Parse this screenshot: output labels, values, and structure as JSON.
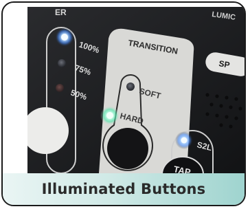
{
  "caption": "Illuminated Buttons",
  "panel": {
    "level_labels": [
      "100%",
      "75%",
      "50%"
    ],
    "transition_title": "TRANSITION",
    "soft_label": "SOFT",
    "hard_label": "HARD",
    "s2l_label": "S2L",
    "tap_label": "TAP",
    "partial_top_label": "ER",
    "partial_right_label": "LUMIC",
    "partial_sp_label": "SP"
  },
  "colors": {
    "led_blue": "#7fb8ff",
    "led_green": "#9fffd0",
    "panel_dark": "#1a1b1d",
    "panel_grey": "#d9d9d6",
    "caption_accent": "#9fd4cf"
  }
}
